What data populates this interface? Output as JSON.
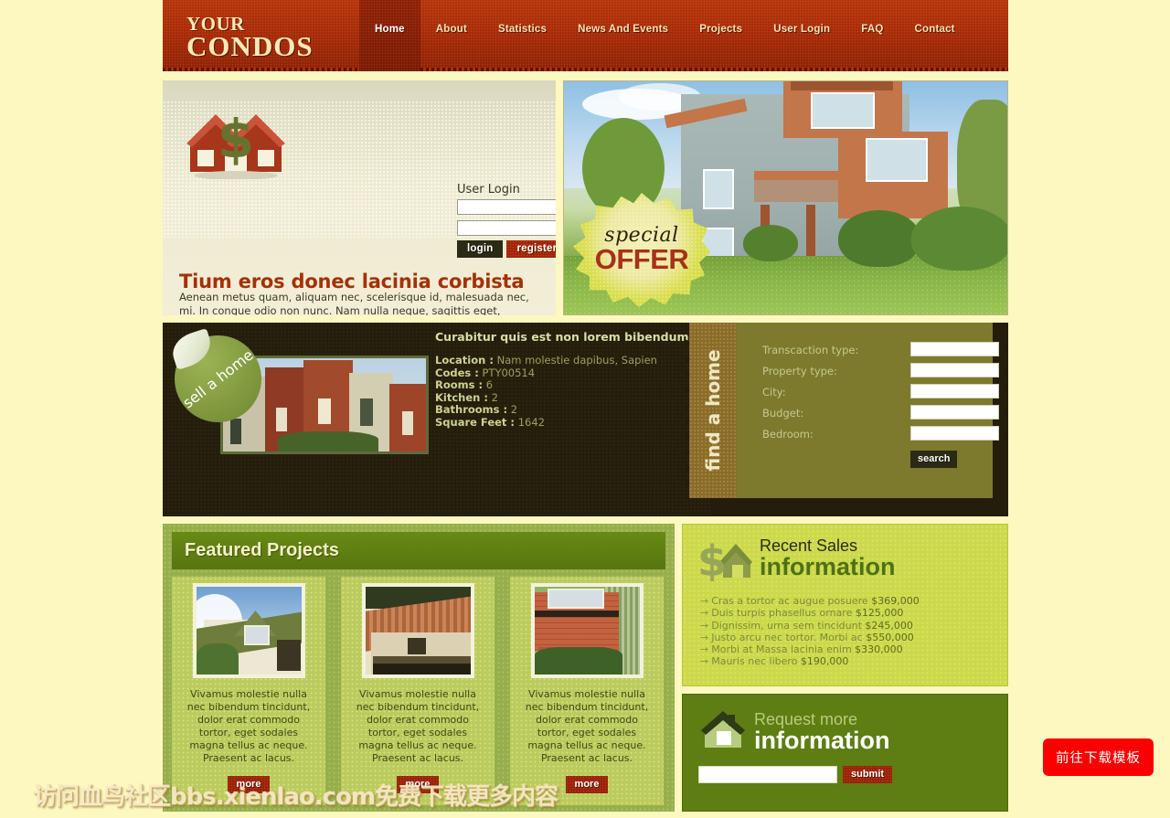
{
  "site": {
    "logo_line1": "YOUR",
    "logo_line2": "CONDOS",
    "background_color": "#FCF8BF",
    "header_color": "#A12A0B",
    "accent_green": "#5E7D12",
    "accent_red": "#9A2309"
  },
  "nav": {
    "items": [
      {
        "label": "Home",
        "active": true
      },
      {
        "label": "About",
        "active": false
      },
      {
        "label": "Statistics",
        "active": false
      },
      {
        "label": "News And Events",
        "active": false
      },
      {
        "label": "Projects",
        "active": false
      },
      {
        "label": "User Login",
        "active": false
      },
      {
        "label": "FAQ",
        "active": false
      },
      {
        "label": "Contact",
        "active": false
      }
    ]
  },
  "login": {
    "title": "User Login",
    "username_value": "",
    "password_value": "",
    "login_button": "login",
    "register_button": "register"
  },
  "lead": {
    "title": "Tium eros donec lacinia corbista",
    "body": "Aenean metus quam, aliquam nec, scelerisque id, malesuada nec, mi. In congue odio non nunc. Nam nulla neque, sagittis eget, tristique id, rhoncus a, mauris. Praesent sodales. Nullam tortor risus, ultricies non, convallis sit amet."
  },
  "hero": {
    "badge_line1": "special",
    "badge_line2": "OFFER"
  },
  "band": {
    "sell_badge": "sell a home",
    "property_title": "Curabitur quis est non lorem bibendum",
    "details": [
      {
        "label": "Location :",
        "value": "Nam molestie dapibus, Sapien"
      },
      {
        "label": "Codes :",
        "value": "PTY00514"
      },
      {
        "label": "Rooms :",
        "value": "6"
      },
      {
        "label": "Kitchen :",
        "value": "2"
      },
      {
        "label": "Bathrooms :",
        "value": "2"
      },
      {
        "label": "Square Feet :",
        "value": "1642"
      }
    ]
  },
  "find_home": {
    "tab_label": "find a home",
    "fields": [
      {
        "label": "Transcaction type:",
        "value": ""
      },
      {
        "label": "Property type:",
        "value": ""
      },
      {
        "label": "City:",
        "value": ""
      },
      {
        "label": "Budget:",
        "value": ""
      },
      {
        "label": "Bedroom:",
        "value": ""
      }
    ],
    "search_button": "search"
  },
  "featured": {
    "title": "Featured Projects",
    "cards": [
      {
        "text": "Vivamus molestie nulla nec bibendum tincidunt, dolor erat commodo tortor, eget sodales magna tellus ac neque. Praesent ac lacus.",
        "button": "more"
      },
      {
        "text": "Vivamus molestie nulla nec bibendum tincidunt, dolor erat commodo tortor, eget sodales magna tellus ac neque. Praesent ac lacus.",
        "button": "more"
      },
      {
        "text": "Vivamus molestie nulla nec bibendum tincidunt, dolor erat commodo tortor, eget sodales magna tellus ac neque. Praesent ac lacus.",
        "button": "more"
      }
    ]
  },
  "recent_sales": {
    "heading_line1": "Recent Sales",
    "heading_line2": "information",
    "items": [
      {
        "text": "Cras a tortor ac augue posuere",
        "price": "$369,000"
      },
      {
        "text": "Duis turpis phasellus ornare",
        "price": "$125,000"
      },
      {
        "text": "Dignissim, urna sem tincidunt",
        "price": "$245,000"
      },
      {
        "text": "Justo arcu nec tortor. Morbi ac",
        "price": "$550,000"
      },
      {
        "text": "Morbi at Massa lacinia enim",
        "price": "$330,000"
      },
      {
        "text": "Mauris nec libero",
        "price": "$190,000"
      }
    ]
  },
  "request_info": {
    "heading_line1": "Request more",
    "heading_line2": "information",
    "input_value": "",
    "submit_button": "submit"
  },
  "overlay": {
    "watermark": "访问血鸟社区bbs.xienlao.com免费下载更多内容",
    "download_button": "前往下载模板"
  }
}
